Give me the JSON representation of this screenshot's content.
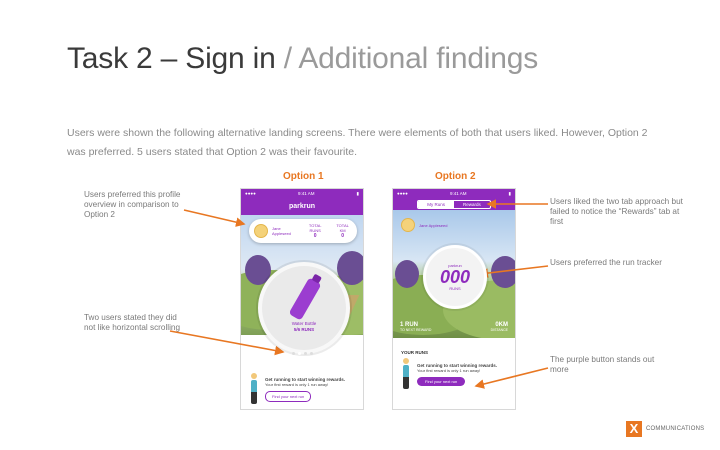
{
  "slide": {
    "title_main": "Task 2 – Sign in",
    "title_sub": " / Additional findings",
    "intro": "Users were shown the following alternative landing screens. There were elements of both that users liked. However, Option 2 was preferred. 5 users stated that Option 2 was their favourite."
  },
  "option1": {
    "label": "Option 1",
    "status_time": "9:41 AM",
    "app_title": "parkrun",
    "user_name": "Jane Appleseed",
    "stat1_label": "TOTAL RUNS",
    "stat1_value": "0",
    "stat2_label": "TOTAL KM",
    "stat2_value": "0",
    "reward_name": "Water Bottle",
    "reward_runs": "5/6 RUNS",
    "cta_title": "Get running to start winning rewards.",
    "cta_sub": "Your first reward is only 1 run away!",
    "button": "Find your next run"
  },
  "option2": {
    "label": "Option 2",
    "status_time": "9:41 AM",
    "tab_my_runs": "My Runs",
    "tab_rewards": "Rewards",
    "user_name": "Jane Appleseed",
    "tracker_top": "parkrun",
    "tracker_value": "000",
    "tracker_unit": "RUNS",
    "left_stat": "1 RUN",
    "left_stat_sub": "TO NEXT REWARD",
    "right_stat": "0KM",
    "right_stat_sub": "DISTANCE",
    "section_title": "YOUR RUNS",
    "cta_title": "Get running to start winning rewards.",
    "cta_sub": "Your first reward is only 1 run away!",
    "button": "Find your next run"
  },
  "annotations": {
    "profile": "Users preferred this profile overview in comparison to Option 2",
    "scroll": "Two users stated they did not like horizontal scrolling",
    "tabs": "Users liked the two tab approach but failed to notice the “Rewards” tab at first",
    "tracker": "Users preferred the run tracker",
    "button": "The purple button stands out more"
  },
  "logo": {
    "mark": "X",
    "name": "COMMUNICATIONS"
  },
  "colors": {
    "accent_orange": "#e87722",
    "brand_purple": "#8e2bbd"
  }
}
